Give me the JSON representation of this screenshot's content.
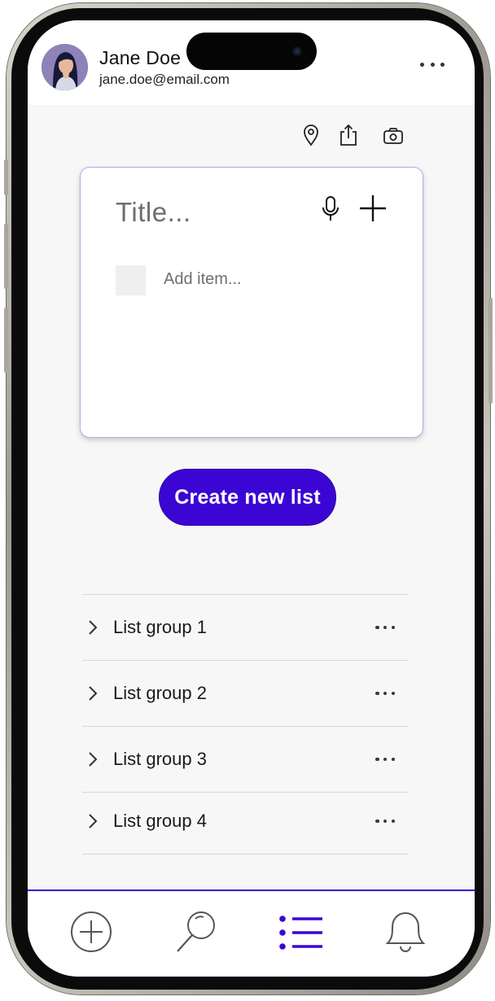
{
  "user": {
    "name": "Jane Doe",
    "email": "jane.doe@email.com",
    "avatar_icon": "user-avatar"
  },
  "header": {
    "more_icon": "more-horizontal-icon"
  },
  "toolbar": {
    "icons": [
      "location-pin-icon",
      "share-icon",
      "camera-icon"
    ]
  },
  "note": {
    "title_placeholder": "Title...",
    "item_placeholder": "Add item...",
    "mic_icon": "microphone-icon",
    "add_icon": "plus-icon"
  },
  "create_button": {
    "label": "Create new list"
  },
  "list_groups": [
    {
      "label": "List group 1"
    },
    {
      "label": "List group 2"
    },
    {
      "label": "List group 3"
    },
    {
      "label": "List group 4"
    }
  ],
  "bottom_nav": {
    "items": [
      {
        "icon": "add-circle-icon",
        "active": false
      },
      {
        "icon": "search-icon",
        "active": false
      },
      {
        "icon": "list-icon",
        "active": true
      },
      {
        "icon": "bell-icon",
        "active": false
      }
    ]
  },
  "colors": {
    "accent": "#3b06d4",
    "card_border": "#b9a9ee",
    "background": "#f7f7f7"
  }
}
